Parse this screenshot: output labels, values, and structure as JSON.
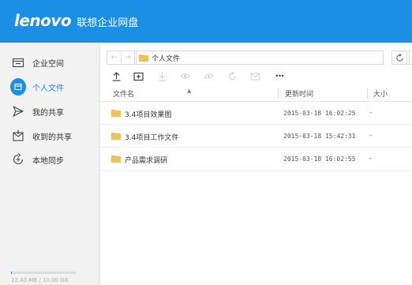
{
  "header": {
    "brand": "lenovo",
    "product": "联想企业网盘",
    "color": "#1a8fe4"
  },
  "sidebar": {
    "items": [
      {
        "label": "企业空间",
        "icon": "enterprise-space-icon",
        "active": false
      },
      {
        "label": "个人文件",
        "icon": "personal-files-icon",
        "active": true
      },
      {
        "label": "我的共享",
        "icon": "my-share-icon",
        "active": false
      },
      {
        "label": "收到的共享",
        "icon": "received-share-icon",
        "active": false
      },
      {
        "label": "本地同步",
        "icon": "local-sync-icon",
        "active": false
      }
    ],
    "storage": {
      "text": "12.43 MB / 10.00 GB",
      "used_fraction": 0.01
    }
  },
  "address_bar": {
    "path": "个人文件",
    "back_icon": "back-arrow-icon",
    "forward_icon": "forward-arrow-icon",
    "refresh_icon": "refresh-icon"
  },
  "toolbar": {
    "items": [
      {
        "name": "upload",
        "icon": "upload-icon",
        "enabled": true
      },
      {
        "name": "new-folder",
        "icon": "new-folder-icon",
        "enabled": true
      },
      {
        "name": "download",
        "icon": "download-icon",
        "enabled": false
      },
      {
        "name": "preview",
        "icon": "eye-icon",
        "enabled": false
      },
      {
        "name": "link",
        "icon": "link-icon",
        "enabled": false
      },
      {
        "name": "share",
        "icon": "share-icon",
        "enabled": false
      },
      {
        "name": "email",
        "icon": "mail-icon",
        "enabled": false
      },
      {
        "name": "more",
        "label": "•••",
        "enabled": true
      }
    ]
  },
  "file_list": {
    "columns": {
      "name": "文件名",
      "time": "更新时间",
      "size": "大小"
    },
    "rows": [
      {
        "name": "3.4项目效果图",
        "time": "2015-03-18 16:02:25",
        "size": "-"
      },
      {
        "name": "3.4项目工作文件",
        "time": "2015-03-18 15:42:31",
        "size": "-"
      },
      {
        "name": "产品需求调研",
        "time": "2015-03-18 16:02:55",
        "size": "-"
      }
    ]
  }
}
